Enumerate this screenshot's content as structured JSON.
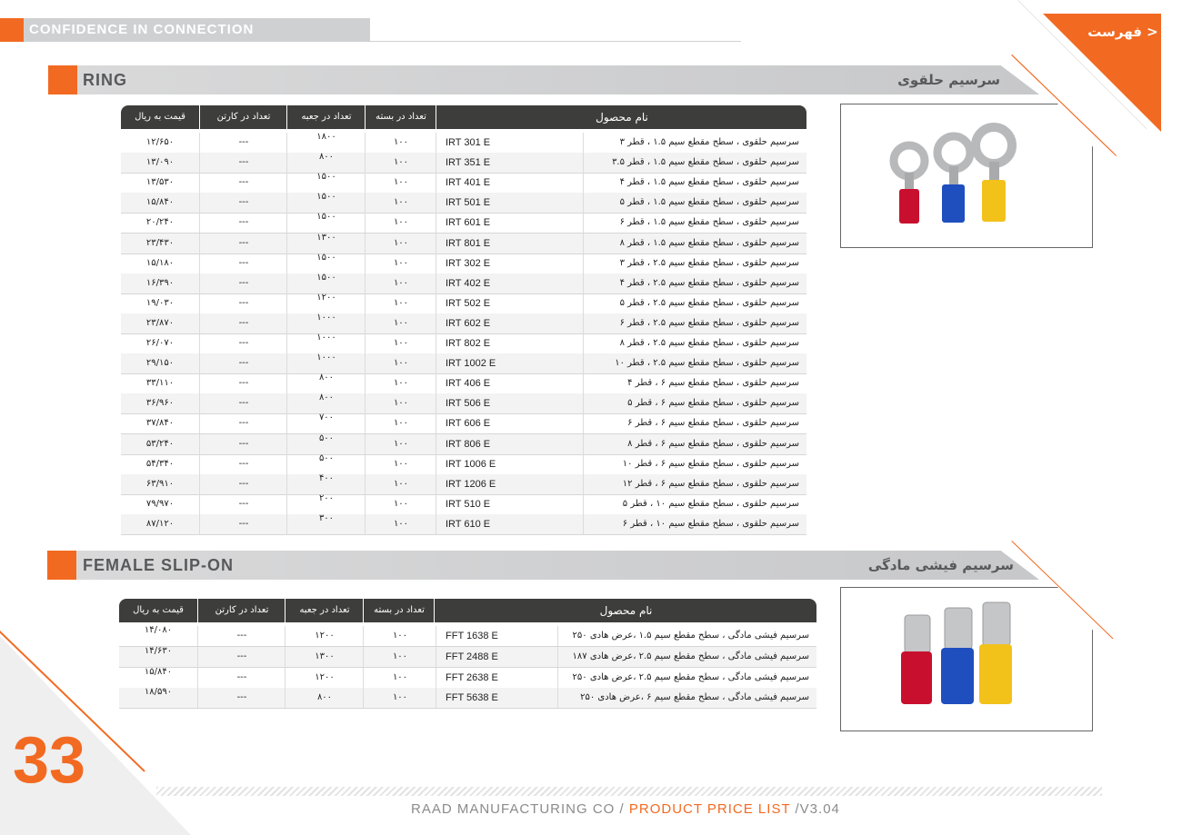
{
  "header": {
    "tagline": "CONFIDENCE IN CONNECTION"
  },
  "menu": {
    "label": "< فهرست"
  },
  "sections": [
    {
      "title_en": "RING",
      "title_fa": "سرسیم حلقوی",
      "columns": {
        "price": "قیمت به ریال",
        "carton": "تعداد در کارتن",
        "box": "تعداد در جعبه",
        "pack": "تعداد در بسته",
        "name": "نام محصول"
      },
      "rows": [
        {
          "price": "۱۲/۶۵۰",
          "carton": "---",
          "box": "۱۸۰۰",
          "pack": "۱۰۰",
          "code": "IRT 301 E",
          "name": "سرسیم حلقوی ، سطح مقطع سیم ۱.۵ ، قطر ۳"
        },
        {
          "price": "۱۳/۰۹۰",
          "carton": "---",
          "box": "۸۰۰",
          "pack": "۱۰۰",
          "code": "IRT 351 E",
          "name": "سرسیم حلقوی ، سطح مقطع سیم ۱.۵ ، قطر ۳.۵"
        },
        {
          "price": "۱۳/۵۳۰",
          "carton": "---",
          "box": "۱۵۰۰",
          "pack": "۱۰۰",
          "code": "IRT 401 E",
          "name": "سرسیم حلقوی ، سطح مقطع سیم ۱.۵ ، قطر ۴"
        },
        {
          "price": "۱۵/۸۴۰",
          "carton": "---",
          "box": "۱۵۰۰",
          "pack": "۱۰۰",
          "code": "IRT 501 E",
          "name": "سرسیم حلقوی ، سطح مقطع سیم ۱.۵ ، قطر ۵"
        },
        {
          "price": "۲۰/۲۴۰",
          "carton": "---",
          "box": "۱۵۰۰",
          "pack": "۱۰۰",
          "code": "IRT 601 E",
          "name": "سرسیم حلقوی ، سطح مقطع سیم ۱.۵ ، قطر ۶"
        },
        {
          "price": "۲۳/۴۳۰",
          "carton": "---",
          "box": "۱۳۰۰",
          "pack": "۱۰۰",
          "code": "IRT 801 E",
          "name": "سرسیم حلقوی ، سطح مقطع سیم ۱.۵ ، قطر ۸"
        },
        {
          "price": "۱۵/۱۸۰",
          "carton": "---",
          "box": "۱۵۰۰",
          "pack": "۱۰۰",
          "code": "IRT 302 E",
          "name": "سرسیم حلقوی ، سطح مقطع سیم ۲.۵ ، قطر ۳"
        },
        {
          "price": "۱۶/۳۹۰",
          "carton": "---",
          "box": "۱۵۰۰",
          "pack": "۱۰۰",
          "code": "IRT 402 E",
          "name": "سرسیم حلقوی ، سطح مقطع سیم ۲.۵ ، قطر ۴"
        },
        {
          "price": "۱۹/۰۳۰",
          "carton": "---",
          "box": "۱۲۰۰",
          "pack": "۱۰۰",
          "code": "IRT 502 E",
          "name": "سرسیم حلقوی ، سطح مقطع سیم ۲.۵ ، قطر ۵"
        },
        {
          "price": "۲۳/۸۷۰",
          "carton": "---",
          "box": "۱۰۰۰",
          "pack": "۱۰۰",
          "code": "IRT 602 E",
          "name": "سرسیم حلقوی ، سطح مقطع سیم ۲.۵ ، قطر ۶"
        },
        {
          "price": "۲۶/۰۷۰",
          "carton": "---",
          "box": "۱۰۰۰",
          "pack": "۱۰۰",
          "code": "IRT 802 E",
          "name": "سرسیم حلقوی ، سطح مقطع سیم ۲.۵ ، قطر ۸"
        },
        {
          "price": "۲۹/۱۵۰",
          "carton": "---",
          "box": "۱۰۰۰",
          "pack": "۱۰۰",
          "code": "IRT 1002 E",
          "name": "سرسیم حلقوی ، سطح مقطع سیم ۲.۵ ، قطر ۱۰"
        },
        {
          "price": "۳۳/۱۱۰",
          "carton": "---",
          "box": "۸۰۰",
          "pack": "۱۰۰",
          "code": "IRT 406 E",
          "name": "سرسیم حلقوی ، سطح مقطع سیم ۶ ، قطر ۴"
        },
        {
          "price": "۳۶/۹۶۰",
          "carton": "---",
          "box": "۸۰۰",
          "pack": "۱۰۰",
          "code": "IRT 506 E",
          "name": "سرسیم حلقوی ، سطح مقطع سیم ۶ ، قطر ۵"
        },
        {
          "price": "۳۷/۸۴۰",
          "carton": "---",
          "box": "۷۰۰",
          "pack": "۱۰۰",
          "code": "IRT 606 E",
          "name": "سرسیم حلقوی ، سطح مقطع سیم ۶ ، قطر ۶"
        },
        {
          "price": "۵۳/۲۴۰",
          "carton": "---",
          "box": "۵۰۰",
          "pack": "۱۰۰",
          "code": "IRT 806 E",
          "name": "سرسیم حلقوی ، سطح مقطع سیم ۶ ، قطر ۸"
        },
        {
          "price": "۵۴/۳۴۰",
          "carton": "---",
          "box": "۵۰۰",
          "pack": "۱۰۰",
          "code": "IRT 1006 E",
          "name": "سرسیم حلقوی ، سطح مقطع سیم ۶ ، قطر ۱۰"
        },
        {
          "price": "۶۳/۹۱۰",
          "carton": "---",
          "box": "۴۰۰",
          "pack": "۱۰۰",
          "code": "IRT 1206 E",
          "name": "سرسیم حلقوی ، سطح مقطع سیم ۶ ، قطر ۱۲"
        },
        {
          "price": "۷۹/۹۷۰",
          "carton": "---",
          "box": "۲۰۰",
          "pack": "۱۰۰",
          "code": "IRT 510 E",
          "name": "سرسیم حلقوی ، سطح مقطع سیم ۱۰ ، قطر ۵"
        },
        {
          "price": "۸۷/۱۲۰",
          "carton": "---",
          "box": "۳۰۰",
          "pack": "۱۰۰",
          "code": "IRT 610 E",
          "name": "سرسیم حلقوی ، سطح مقطع سیم ۱۰ ، قطر ۶"
        }
      ]
    },
    {
      "title_en": "FEMALE SLIP-ON",
      "title_fa": "سرسیم فیشی مادگی",
      "columns": {
        "price": "قیمت به ریال",
        "carton": "تعداد در کارتن",
        "box": "تعداد در جعبه",
        "pack": "تعداد در بسته",
        "name": "نام محصول"
      },
      "rows": [
        {
          "price": "۱۴/۰۸۰",
          "carton": "---",
          "box": "۱۲۰۰",
          "pack": "۱۰۰",
          "code": "FFT 1638 E",
          "name": "سرسیم فیشی مادگی ، سطح مقطع سیم ۱.۵ ،عرض هادی ۲۵۰"
        },
        {
          "price": "۱۴/۶۳۰",
          "carton": "---",
          "box": "۱۳۰۰",
          "pack": "۱۰۰",
          "code": "FFT 2488 E",
          "name": "سرسیم فیشی مادگی ، سطح مقطع سیم ۲.۵ ،عرض هادی ۱۸۷"
        },
        {
          "price": "۱۵/۸۴۰",
          "carton": "---",
          "box": "۱۲۰۰",
          "pack": "۱۰۰",
          "code": "FFT 2638 E",
          "name": "سرسیم فیشی مادگی ، سطح مقطع سیم ۲.۵ ،عرض هادی ۲۵۰"
        },
        {
          "price": "۱۸/۵۹۰",
          "carton": "---",
          "box": "۸۰۰",
          "pack": "۱۰۰",
          "code": "FFT 5638 E",
          "name": "سرسیم فیشی مادگی ، سطح مقطع سیم ۶ ،عرض هادی ۲۵۰"
        }
      ]
    }
  ],
  "footer": {
    "page_number": "33",
    "company": "RAAD MANUFACTURING CO / ",
    "doc": "PRODUCT PRICE LIST",
    "version": " /V3.04"
  },
  "colors": {
    "accent": "#f26a21",
    "header_dark": "#3d3e3b",
    "band_gray": "#cfd0d2",
    "ring_red": "#c8102e",
    "ring_blue": "#1f4fbf",
    "ring_yellow": "#f2c21a"
  }
}
